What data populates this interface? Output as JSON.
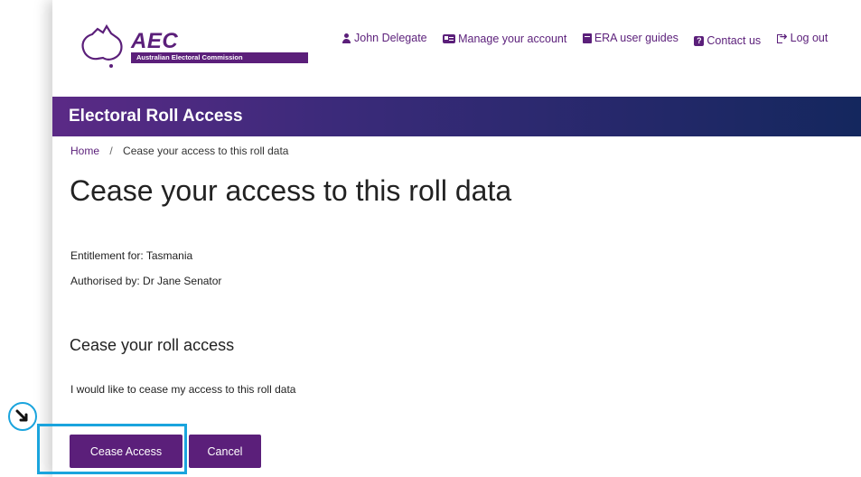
{
  "logo": {
    "name": "AEC",
    "subtitle": "Australian Electoral Commission"
  },
  "topnav": {
    "user": "John Delegate",
    "manage": "Manage your account",
    "guides": "ERA user guides",
    "contact": "Contact us",
    "logout": "Log out"
  },
  "banner": {
    "title": "Electoral Roll Access"
  },
  "breadcrumb": {
    "home": "Home",
    "separator": "/",
    "current": "Cease your access to this roll data"
  },
  "main": {
    "title": "Cease your access to this roll data",
    "entitlement": "Entitlement for: Tasmania",
    "authorised": "Authorised by: Dr Jane Senator",
    "section_title": "Cease your roll access",
    "description": "I would like to cease my access to this roll data",
    "cease_button": "Cease Access",
    "cancel_button": "Cancel"
  },
  "colors": {
    "brand": "#5b1f7a",
    "banner_end": "#14275e",
    "highlight": "#1aa4dd"
  },
  "icons": [
    "map-australia-icon",
    "user-icon",
    "id-card-icon",
    "book-icon",
    "question-icon",
    "sign-out-icon",
    "pointer-arrow-icon"
  ]
}
